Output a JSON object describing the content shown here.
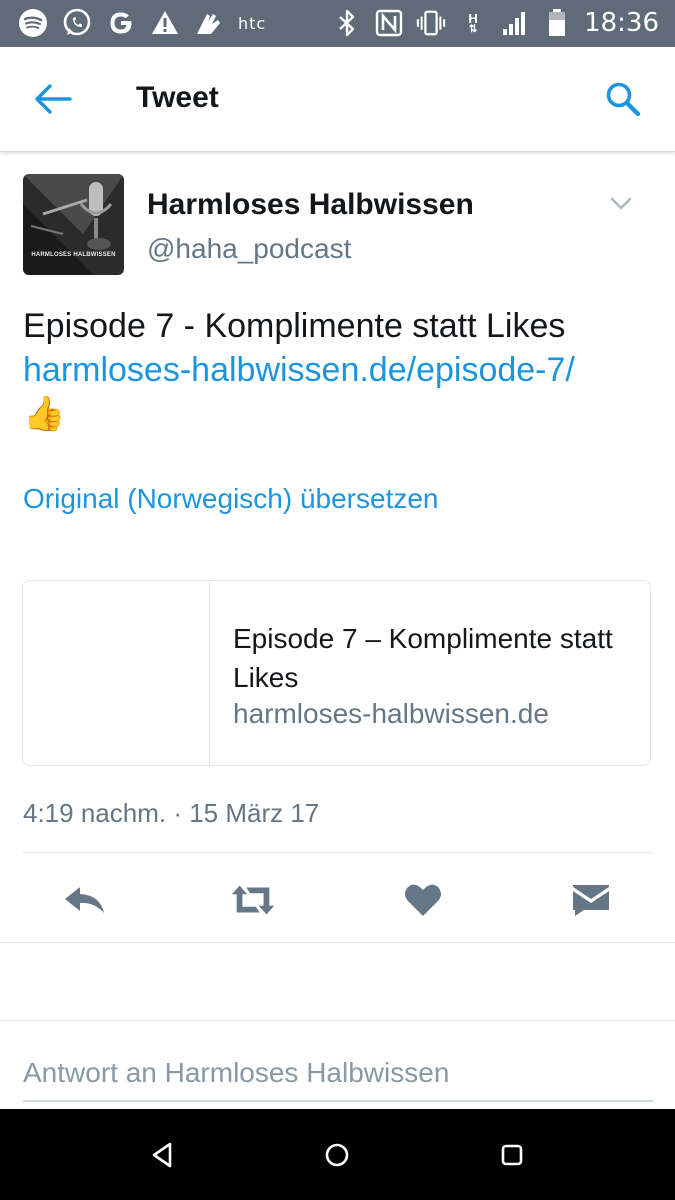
{
  "status_bar": {
    "carrier_logo": "htc",
    "time": "18:36",
    "network_label": "H",
    "icons": [
      "spotify-icon",
      "whatsapp-icon",
      "google-icon",
      "warning-icon",
      "hands-icon",
      "bluetooth-icon",
      "nfc-icon",
      "vibrate-icon",
      "signal-icon",
      "battery-icon"
    ]
  },
  "app_bar": {
    "title": "Tweet"
  },
  "tweet": {
    "author_name": "Harmloses Halbwissen",
    "author_handle": "@haha_podcast",
    "avatar_text": "HARMLOSES HALBWISSEN",
    "text": "Episode 7 - Komplimente statt Likes",
    "link": "harmloses-halbwissen.de/episode-7/",
    "emoji": "👍",
    "translate_label": "Original (Norwegisch) übersetzen",
    "card": {
      "title": "Episode 7 – Komplimente statt Likes",
      "domain": "harmloses-halbwissen.de"
    },
    "timestamp": "4:19 nachm. · 15 März 17"
  },
  "reply": {
    "placeholder": "Antwort an Harmloses Halbwissen"
  },
  "colors": {
    "accent": "#1b95e0",
    "secondary_text": "#657786",
    "action_icon": "#657786",
    "status_bar_bg": "#5f6b79"
  }
}
